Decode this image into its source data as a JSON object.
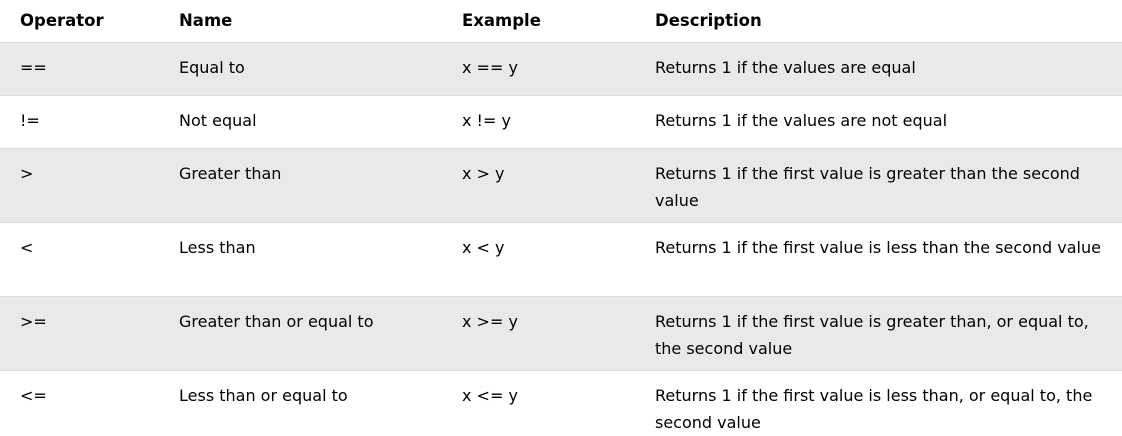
{
  "table": {
    "headers": {
      "operator": "Operator",
      "name": "Name",
      "example": "Example",
      "description": "Description"
    },
    "rows": [
      {
        "operator": "==",
        "name": "Equal to",
        "example": "x == y",
        "description": "Returns 1 if the values are equal"
      },
      {
        "operator": "!=",
        "name": "Not equal",
        "example": "x != y",
        "description": "Returns 1 if the values are not equal"
      },
      {
        "operator": ">",
        "name": "Greater than",
        "example": "x > y",
        "description": "Returns 1 if the first value is greater than the second value"
      },
      {
        "operator": "<",
        "name": "Less than",
        "example": "x < y",
        "description": "Returns 1 if the first value is less than the second value"
      },
      {
        "operator": ">=",
        "name": "Greater than or equal to",
        "example": "x >= y",
        "description": "Returns 1 if the first value is greater than, or equal to, the second value"
      },
      {
        "operator": "<=",
        "name": "Less than or equal to",
        "example": "x <= y",
        "description": "Returns 1 if the first value is less than, or equal to, the second value"
      }
    ]
  }
}
